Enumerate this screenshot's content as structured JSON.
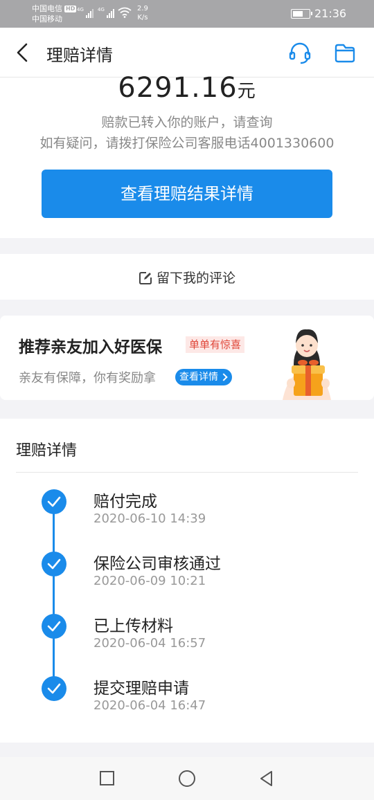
{
  "status_bar": {
    "carrier1": "中国电信",
    "hd_badge": "HD",
    "carrier2": "中国移动",
    "network1": "4G",
    "network2": "4G",
    "speed_value": "2.9",
    "speed_unit": "K/s",
    "time": "21:36"
  },
  "nav": {
    "title": "理赔详情",
    "icons": [
      "back-icon",
      "customer-service-icon",
      "folder-icon"
    ]
  },
  "payout": {
    "amount": "6291.16",
    "unit": "元",
    "note_transferred": "赔款已转入你的账户，请查询",
    "note_contact": "如有疑问，请拨打保险公司客服电话4001330600",
    "detail_button": "查看理赔结果详情"
  },
  "comment": {
    "label": "留下我的评论"
  },
  "promo": {
    "title": "推荐亲友加入好医保",
    "tag": "单单有惊喜",
    "subtitle": "亲友有保障，你有奖励拿",
    "link": "查看详情"
  },
  "claim_detail": {
    "heading": "理赔详情",
    "steps": [
      {
        "title": "赔付完成",
        "time": "2020-06-10 14:39"
      },
      {
        "title": "保险公司审核通过",
        "time": "2020-06-09 10:21"
      },
      {
        "title": "已上传材料",
        "time": "2020-06-04 16:57"
      },
      {
        "title": "提交理赔申请",
        "time": "2020-06-04 16:47"
      }
    ]
  },
  "colors": {
    "accent": "#1a8bea",
    "tag_red": "#e0483a",
    "muted": "#888888"
  }
}
